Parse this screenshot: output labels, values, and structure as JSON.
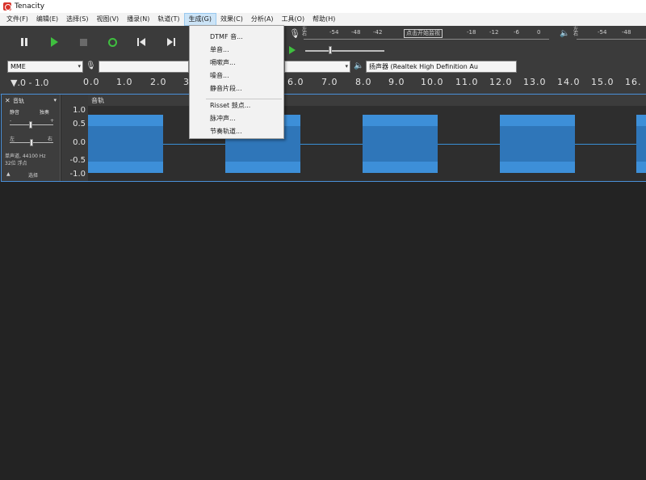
{
  "window": {
    "title": "Tenacity"
  },
  "menubar": {
    "items": [
      "文件(F)",
      "编辑(E)",
      "选择(S)",
      "视图(V)",
      "播录(N)",
      "轨道(T)",
      "生成(G)",
      "效果(C)",
      "分析(A)",
      "工具(O)",
      "帮助(H)"
    ],
    "active_index": 6
  },
  "generate_menu": {
    "items": [
      "DTMF 音...",
      "单音...",
      "嗝嗽声...",
      "噪音...",
      "静音片段...",
      "Risset 鼓点...",
      "脉冲声...",
      "节奏轨道..."
    ]
  },
  "toolbar": {
    "transport_icons": [
      "pause-icon",
      "play-icon",
      "stop-icon",
      "loop-icon",
      "skip-to-start-icon",
      "skip-to-end-icon"
    ],
    "record_meter": {
      "lr": [
        "左",
        "右"
      ],
      "scale": [
        "-54",
        "-48",
        "-42",
        "-18",
        "-12",
        "-6",
        "0"
      ],
      "monitor_label": "点击开始监视"
    },
    "playback_meter": {
      "lr": [
        "左",
        "右"
      ],
      "scale": [
        "-54",
        "-48"
      ]
    },
    "host_select": "MME",
    "output_device": "扬声器 (Realtek High Definition Au"
  },
  "ruler": {
    "lead": "▼.0  - 1.0",
    "ticks": [
      "0.0",
      "1.0",
      "2.0",
      "3.",
      "6.0",
      "7.0",
      "8.0",
      "9.0",
      "10.0",
      "11.0",
      "12.0",
      "13.0",
      "14.0",
      "15.0",
      "16."
    ]
  },
  "track": {
    "header": "音轨",
    "mute_label": "静音",
    "solo_label": "独奏",
    "gain_minus": "-",
    "gain_plus": "+",
    "pan_left": "左",
    "pan_right": "右",
    "rate_info": "单声道, 44100 Hz",
    "format_info": "32位 浮点",
    "select_label": "选择",
    "clip_name": "音轨",
    "scale": [
      "1.0",
      "0.5",
      "0.0",
      "-0.5",
      "-1.0"
    ]
  },
  "colors": {
    "waveform": "#3d8fd8",
    "waveform_rms": "#2f76b9",
    "play_green": "#3fbf3f",
    "background": "#232323"
  }
}
